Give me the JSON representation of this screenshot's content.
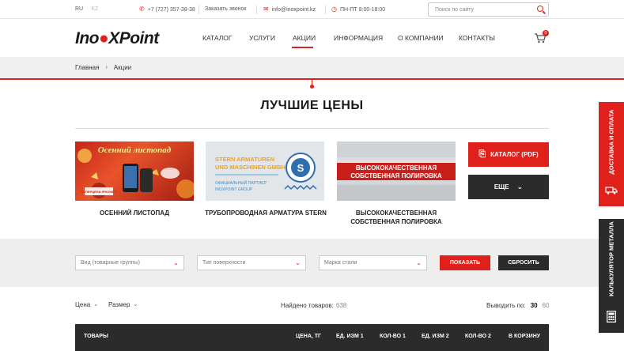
{
  "topbar": {
    "lang_active": "RU",
    "lang_sep": "·",
    "lang_inactive": "KZ",
    "phone": "+7 (727) 357-38-38",
    "callback": "Заказать звонок",
    "email": "info@inoxpoint.kz",
    "hours": "ПН-ПТ  9:00-18:00",
    "search_placeholder": "Поиск по сайту"
  },
  "logo": {
    "part1": "Ino",
    "part2": "X",
    "part3": "Point"
  },
  "nav": {
    "items": [
      "КАТАЛОГ",
      "УСЛУГИ",
      "АКЦИИ",
      "ИНФОРМАЦИЯ",
      "О КОМПАНИИ",
      "КОНТАКТЫ"
    ],
    "active": "АКЦИИ"
  },
  "cart": {
    "count": "0"
  },
  "breadcrumb": {
    "home": "Главная",
    "separator": "›",
    "current": "Акции"
  },
  "page_title": "ЛУЧШИЕ ЦЕНЫ",
  "promos": [
    {
      "title": "ОСЕННИЙ ЛИСТОПАД",
      "image_headline": "Осенний листопад",
      "image_badge": "СУПЕРЦЕНА iPHONE 7"
    },
    {
      "title": "ТРУБОПРОВОДНАЯ АРМАТУРА STERN",
      "image_line1": "STERN ARMATUREN",
      "image_line2": "UND MASCHINEN GMBH",
      "image_line3": "ОФИЦИАЛЬНЫЙ ПАРТНЕР",
      "image_line4": "INOXPOINT GROUP"
    },
    {
      "title": "ВЫСОКОКАЧЕСТВЕННАЯ СОБСТВЕННАЯ ПОЛИРОВКА",
      "image_line1": "ВЫСОКОКАЧЕСТВЕННАЯ",
      "image_line2": "СОБСТВЕННАЯ ПОЛИРОВКА"
    }
  ],
  "buttons": {
    "catalog": "КАТАЛОГ (PDF)",
    "more": "ЕЩЕ"
  },
  "filters": {
    "group": "Вид (товарные группы)",
    "surface": "Тип поверхности",
    "steel": "Марка стали",
    "show": "ПОКАЗАТЬ",
    "reset": "СБРОСИТЬ"
  },
  "sort": {
    "price": "Цена",
    "size": "Размер",
    "found_label": "Найдено товаров:",
    "found_count": "638",
    "perpage_label": "Выводить по:",
    "perpage_options": [
      "30",
      "60"
    ],
    "perpage_selected": "30"
  },
  "table": {
    "headers": [
      "ТОВАРЫ",
      "ЦЕНА, ТГ",
      "ЕД. ИЗМ 1",
      "КОЛ-ВО 1",
      "ЕД. ИЗМ 2",
      "КОЛ-ВО 2",
      "В КОРЗИНУ"
    ]
  },
  "side": {
    "delivery": "Доставка и оплата",
    "calculator": "Калькулятор металла"
  },
  "colors": {
    "accent": "#e0201b",
    "dark": "#2b2b2b",
    "band": "#eeeeee"
  }
}
